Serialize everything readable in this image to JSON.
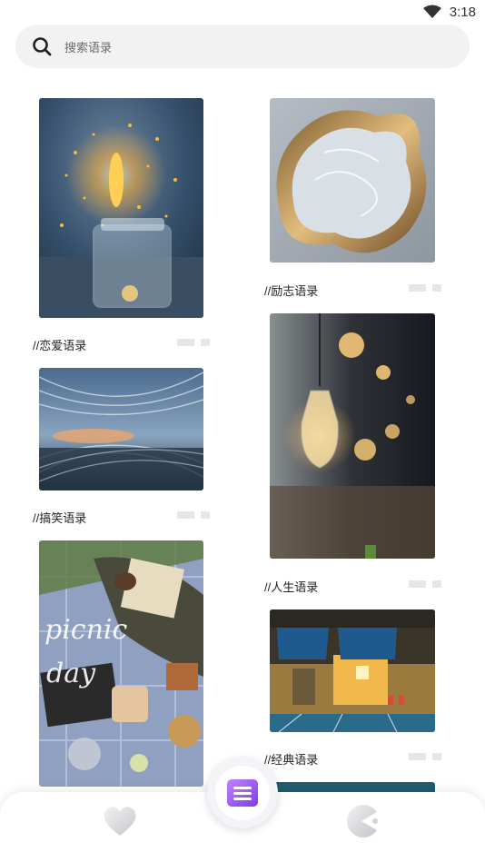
{
  "status": {
    "time": "3:18"
  },
  "search": {
    "placeholder": "搜索语录"
  },
  "feed": {
    "left": [
      {
        "label": "//恋爱语录",
        "image": "sparkler-in-jar-photo"
      },
      {
        "label": "//搞笑语录",
        "image": "motion-blur-tunnel-photo"
      },
      {
        "image": "picnic-day-photo",
        "overlay_text_line1": "picnic",
        "overlay_text_line2": "day"
      }
    ],
    "right": [
      {
        "label": "//励志语录",
        "image": "glass-sculpture-photo"
      },
      {
        "label": "//人生语录",
        "image": "hanging-lamps-photo"
      },
      {
        "label": "//经典语录",
        "image": "night-storefront-photo"
      },
      {
        "image": "teal-photo-partial"
      }
    ]
  },
  "tabbar": {
    "left_icon": "heart-icon",
    "center_icon": "menu-book-icon",
    "right_icon": "pacman-icon",
    "accent": "#8b5cf6"
  }
}
